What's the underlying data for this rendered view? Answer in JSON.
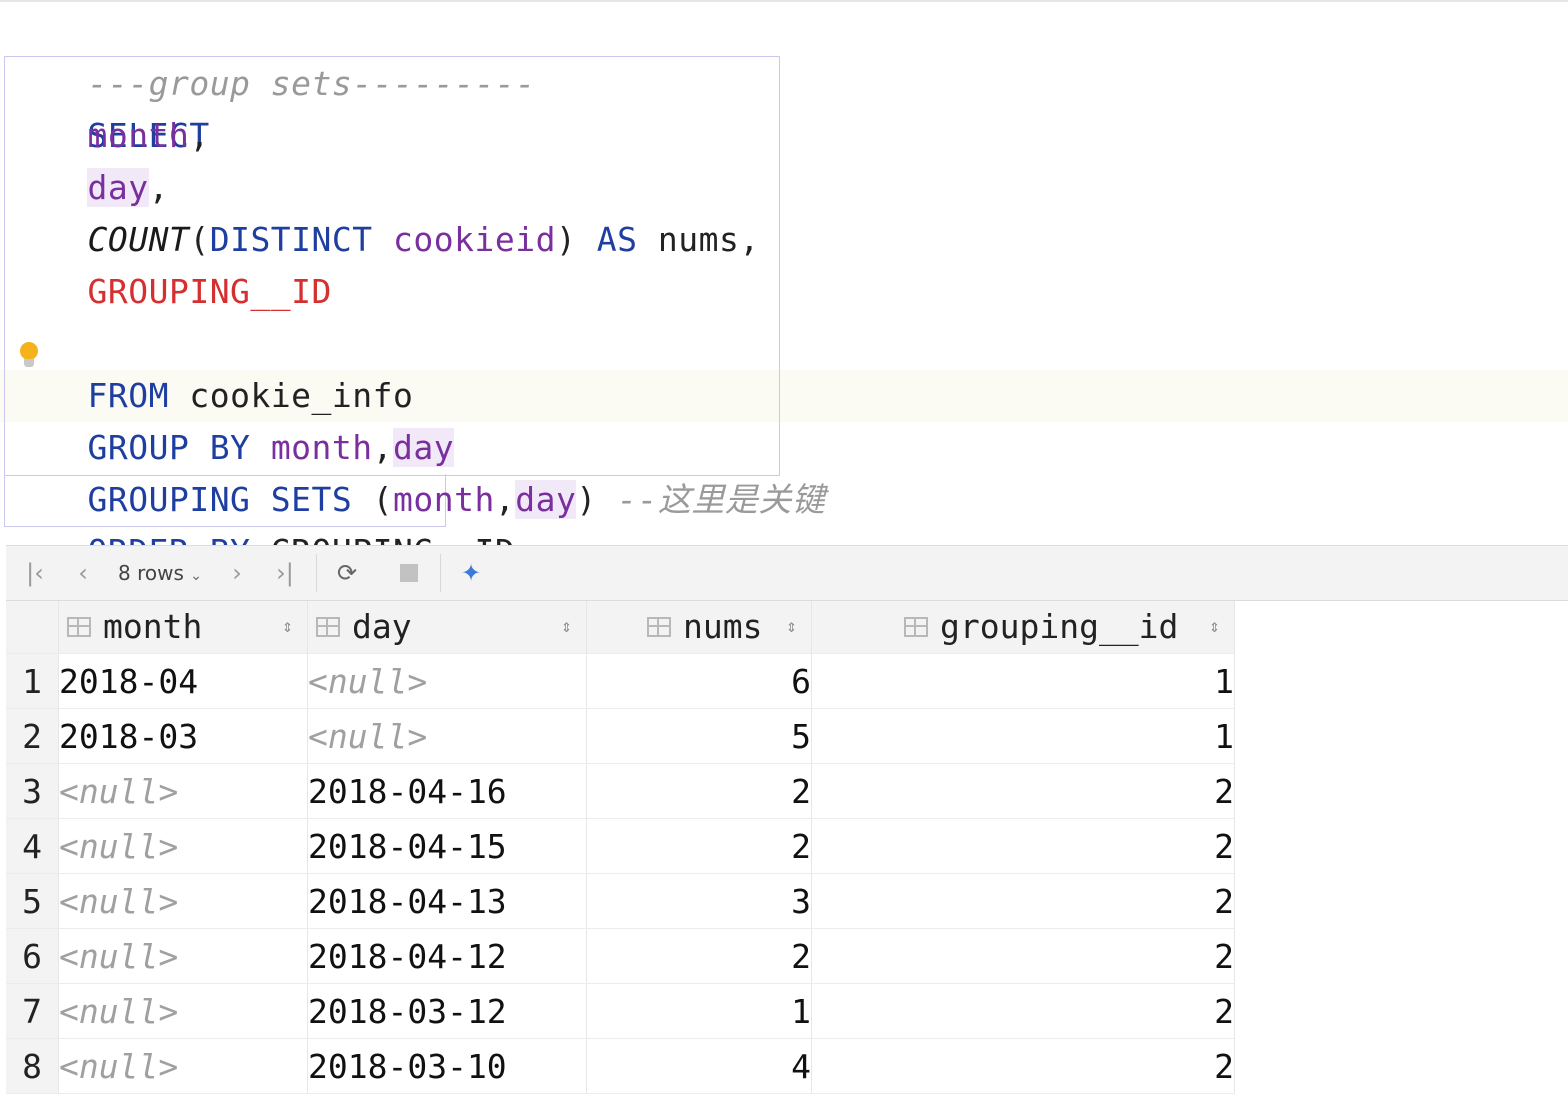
{
  "editor": {
    "comment_header": "---group sets---------",
    "lines": {
      "select": "SELECT",
      "col_month": "month",
      "col_day": "day",
      "count_fn": "COUNT",
      "distinct": "DISTINCT",
      "cookieid": "cookieid",
      "as": "AS",
      "nums": "nums",
      "grouping_id": "GROUPING__ID",
      "from": "FROM",
      "table": "cookie_info",
      "group_by": "GROUP BY",
      "grouping_sets": "GROUPING SETS",
      "comment_key": "--这里是关键",
      "order_by": "ORDER BY"
    }
  },
  "results": {
    "toolbar": {
      "first_icon": "first-page-icon",
      "prev_icon": "previous-page-icon",
      "rows_label": "8 rows",
      "next_icon": "next-page-icon",
      "last_icon": "last-page-icon",
      "refresh_icon": "refresh-icon",
      "stop_icon": "stop-icon",
      "pin_icon": "pin-icon"
    },
    "columns": [
      "month",
      "day",
      "nums",
      "grouping__id"
    ],
    "null_text": "<null>",
    "rows": [
      {
        "n": "1",
        "month": "2018-04",
        "day": "<null>",
        "nums": "6",
        "gid": "1"
      },
      {
        "n": "2",
        "month": "2018-03",
        "day": "<null>",
        "nums": "5",
        "gid": "1"
      },
      {
        "n": "3",
        "month": "<null>",
        "day": "2018-04-16",
        "nums": "2",
        "gid": "2"
      },
      {
        "n": "4",
        "month": "<null>",
        "day": "2018-04-15",
        "nums": "2",
        "gid": "2"
      },
      {
        "n": "5",
        "month": "<null>",
        "day": "2018-04-13",
        "nums": "3",
        "gid": "2"
      },
      {
        "n": "6",
        "month": "<null>",
        "day": "2018-04-12",
        "nums": "2",
        "gid": "2"
      },
      {
        "n": "7",
        "month": "<null>",
        "day": "2018-03-12",
        "nums": "1",
        "gid": "2"
      },
      {
        "n": "8",
        "month": "<null>",
        "day": "2018-03-10",
        "nums": "4",
        "gid": "2"
      }
    ]
  }
}
